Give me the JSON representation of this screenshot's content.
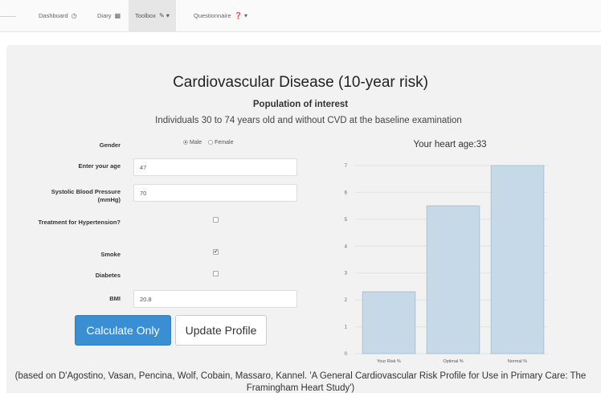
{
  "navbar": {
    "items": [
      {
        "label": "Dashboard",
        "icon": "◷"
      },
      {
        "label": "Diary",
        "icon": "▦"
      },
      {
        "label": "Toolbox",
        "icon": "✎ ▾"
      },
      {
        "label": "Questionnaire",
        "icon": "❓ ▾"
      }
    ]
  },
  "page": {
    "title": "Cardiovascular Disease (10-year risk)",
    "subtitle": "Population of interest",
    "description": "Individuals 30 to 74 years old and without CVD at the baseline examination"
  },
  "form": {
    "gender_label": "Gender",
    "gender_options": [
      "Male",
      "Female"
    ],
    "gender_selected": "Male",
    "age_label": "Enter your age",
    "age_value": "47",
    "sbp_label": "Systolic Blood Pressure (mmHg)",
    "sbp_value": "70",
    "treatment_label": "Treatment for Hypertension?",
    "treatment_checked": false,
    "smoke_label": "Smoke",
    "smoke_checked": true,
    "diabetes_label": "Diabetes",
    "diabetes_checked": false,
    "bmi_label": "BMI",
    "bmi_value": "20.8",
    "calculate_label": "Calculate Only",
    "update_label": "Update Profile"
  },
  "result": {
    "heart_age": "Your heart age:33"
  },
  "chart_data": {
    "type": "bar",
    "categories": [
      "Your Risk %",
      "Optimal %",
      "Normal %"
    ],
    "values": [
      2.3,
      5.5,
      7.0
    ],
    "ylim": [
      0,
      7
    ],
    "yticks": [
      "0",
      "1",
      "2",
      "3",
      "4",
      "5",
      "6",
      "7"
    ],
    "bar_color": "#c5d9e6",
    "bar_border": "#a9c2d3",
    "grid": true
  },
  "footer": {
    "citation": "(based on D'Agostino, Vasan, Pencina, Wolf, Cobain, Massaro, Kannel. 'A General Cardiovascular Risk Profile for Use in Primary Care: The Framingham Heart Study')"
  }
}
